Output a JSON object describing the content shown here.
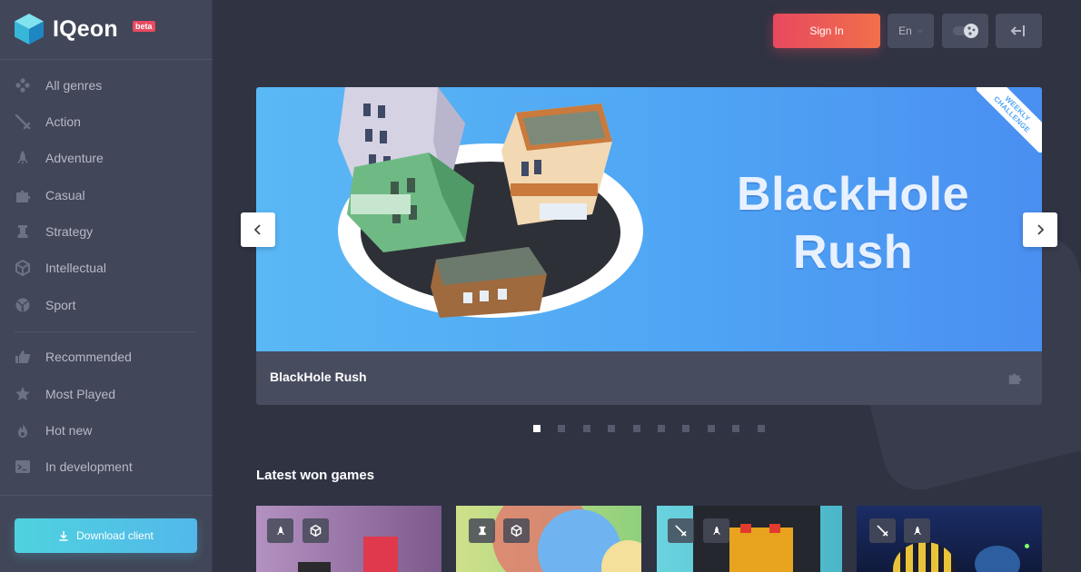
{
  "brand": {
    "name": "IQeon",
    "badge": "beta",
    "icon": "cube-logo-icon"
  },
  "sidebar": {
    "genres": [
      {
        "label": "All genres",
        "icon": "gamepad-icon"
      },
      {
        "label": "Action",
        "icon": "sword-icon"
      },
      {
        "label": "Adventure",
        "icon": "rocket-icon"
      },
      {
        "label": "Casual",
        "icon": "puzzle-icon"
      },
      {
        "label": "Strategy",
        "icon": "chess-rook-icon"
      },
      {
        "label": "Intellectual",
        "icon": "cube-icon"
      },
      {
        "label": "Sport",
        "icon": "ball-icon"
      }
    ],
    "lists": [
      {
        "label": "Recommended",
        "icon": "thumbs-up-icon"
      },
      {
        "label": "Most Played",
        "icon": "star-icon"
      },
      {
        "label": "Hot new",
        "icon": "flame-icon"
      },
      {
        "label": "In development",
        "icon": "terminal-icon"
      }
    ],
    "download_label": "Download client"
  },
  "header": {
    "signin_label": "Sign In",
    "language": "En",
    "theme_icon": "theme-toggle-icon",
    "logout_icon": "exit-icon"
  },
  "carousel": {
    "game_title": "BlackHole Rush",
    "art_title_line1": "BlackHole",
    "art_title_line2": "Rush",
    "ribbon_line1": "WEEKLY",
    "ribbon_line2": "CHALLENGE",
    "genre_icon": "puzzle-icon",
    "slide_count": 10,
    "active_slide": 1
  },
  "latest": {
    "title": "Latest won games",
    "cards": [
      {
        "tags": [
          "rocket-icon",
          "cube-icon"
        ],
        "bg": "#8e6e9c"
      },
      {
        "tags": [
          "chess-rook-icon",
          "cube-icon"
        ],
        "bg": "#a8d27a"
      },
      {
        "tags": [
          "sword-icon",
          "rocket-icon"
        ],
        "bg": "#5cc7d6"
      },
      {
        "tags": [
          "sword-icon",
          "rocket-icon"
        ],
        "bg": "#1c2a58"
      }
    ]
  },
  "colors": {
    "accent_signin": "#e8485f",
    "accent_download": "#4fd2df",
    "sidebar_bg": "#414658",
    "page_bg": "#2f3342"
  }
}
